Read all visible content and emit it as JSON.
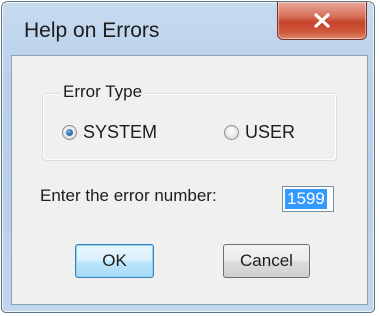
{
  "window": {
    "title": "Help on Errors",
    "close_icon": "close-icon"
  },
  "error_type": {
    "label": "Error Type",
    "options": [
      {
        "label": "SYSTEM",
        "checked": true
      },
      {
        "label": "USER",
        "checked": false
      }
    ]
  },
  "error_number": {
    "label": "Enter the error number:",
    "value": "1599"
  },
  "buttons": {
    "ok": "OK",
    "cancel": "Cancel"
  },
  "colors": {
    "accent": "#3399ff",
    "close_button": "#c5432b"
  }
}
